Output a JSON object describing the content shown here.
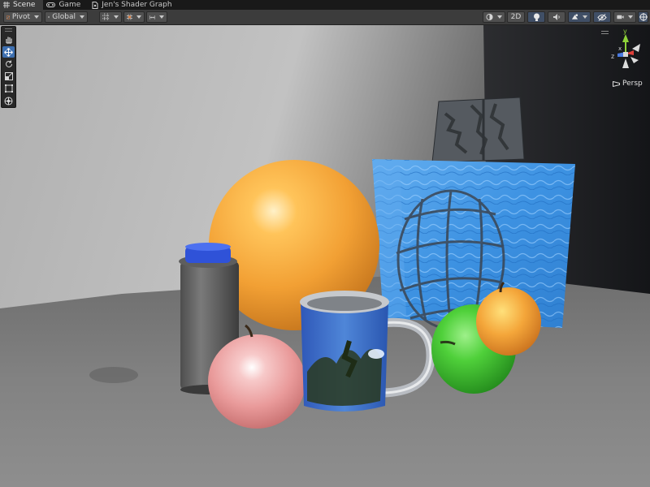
{
  "tabs": [
    {
      "label": "Scene",
      "icon": "grid-icon",
      "active": true
    },
    {
      "label": "Game",
      "icon": "gamepad-icon",
      "active": false
    },
    {
      "label": "Jen's Shader Graph",
      "icon": "shader-graph-icon",
      "active": false
    }
  ],
  "toolbar": {
    "pivot_label": "Pivot",
    "global_label": "Global",
    "mode_2d_label": "2D"
  },
  "viewport": {
    "camera_mode": "Persp",
    "axes": {
      "y": "y",
      "x": "x",
      "z": "z"
    }
  },
  "colors": {
    "accent": "#3d6fb0",
    "axis_x": "#e0403a",
    "axis_y": "#8fd23a",
    "axis_z": "#4a7ae0",
    "background": "#191919",
    "toolbar": "#3c3c3c"
  },
  "icons": [
    "hand-icon",
    "move-icon",
    "rotate-icon",
    "scale-icon",
    "rect-tool-icon",
    "transform-icon",
    "grid-snap-icon",
    "increment-snap-icon",
    "shading-mode-icon",
    "lighting-icon",
    "audio-icon",
    "effects-icon",
    "visibility-icon",
    "camera-icon",
    "gizmos-icon",
    "lock-icon"
  ]
}
